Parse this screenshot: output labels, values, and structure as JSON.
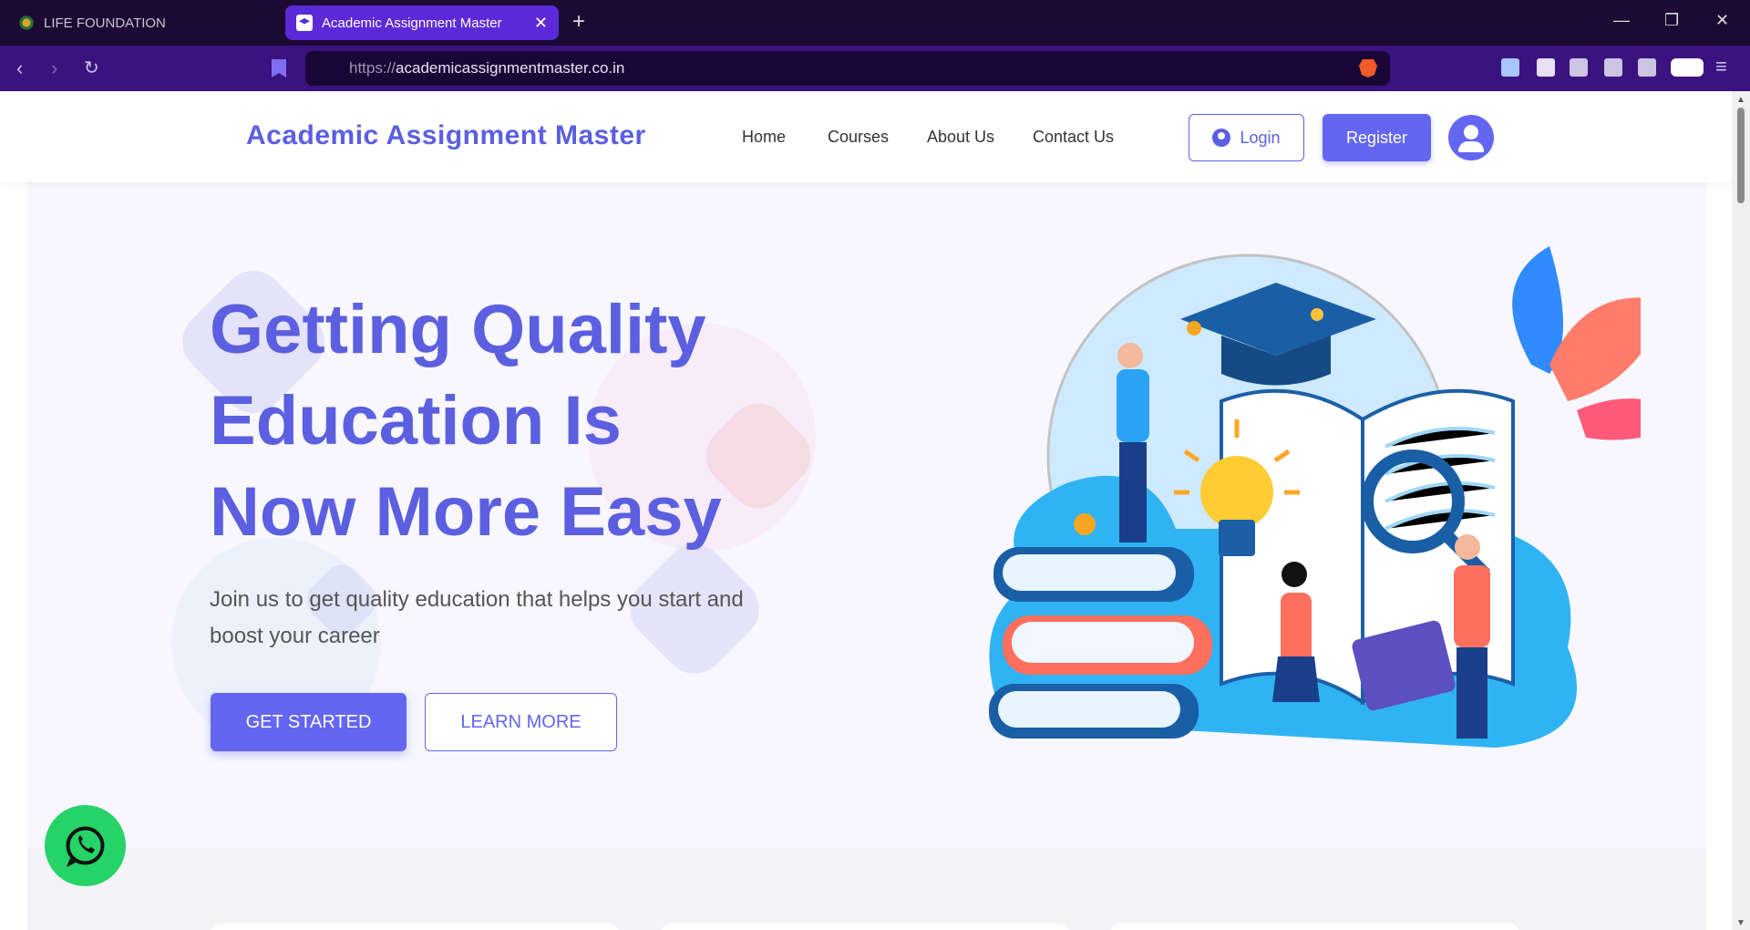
{
  "browser": {
    "tabs": [
      {
        "title": "LIFE FOUNDATION",
        "active": false
      },
      {
        "title": "Academic Assignment Master",
        "active": true
      }
    ],
    "url_protocol": "https://",
    "url_host": "academicassignmentmaster.co.in"
  },
  "header": {
    "brand": "Academic Assignment Master",
    "nav": [
      "Home",
      "Courses",
      "About Us",
      "Contact Us"
    ],
    "login_label": "Login",
    "register_label": "Register"
  },
  "hero": {
    "title_lines": [
      "Getting Quality",
      "Education Is",
      "Now More Easy"
    ],
    "subtitle": "Join us to get quality education that helps you start and boost your career",
    "primary_cta": "GET STARTED",
    "secondary_cta": "LEARN MORE"
  },
  "colors": {
    "brand": "#5b5fe0",
    "primary": "#6366f1",
    "whatsapp": "#25d366"
  },
  "icons": [
    "whatsapp-icon",
    "user-icon",
    "avatar-icon"
  ]
}
